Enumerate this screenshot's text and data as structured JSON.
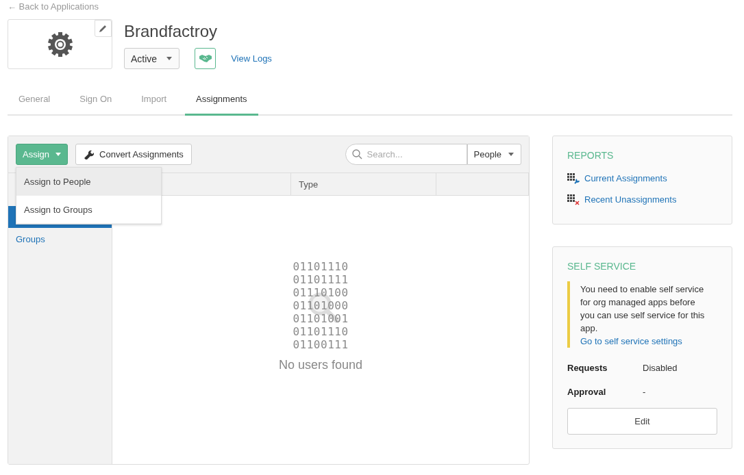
{
  "back_link": "← Back to Applications",
  "app": {
    "name": "Brandfactroy",
    "status": "Active",
    "view_logs": "View Logs"
  },
  "tabs": [
    {
      "label": "General",
      "selected": false
    },
    {
      "label": "Sign On",
      "selected": false
    },
    {
      "label": "Import",
      "selected": false
    },
    {
      "label": "Assignments",
      "selected": true
    }
  ],
  "toolbar": {
    "assign": "Assign",
    "convert": "Convert Assignments",
    "search": {
      "placeholder": "Search..."
    },
    "filter": "People"
  },
  "assign_menu": [
    {
      "label": "Assign to People",
      "selected": true
    },
    {
      "label": "Assign to Groups",
      "selected": false
    }
  ],
  "sidebar": {
    "items": [
      {
        "selected": true
      },
      {
        "label": "Groups",
        "selected": false
      }
    ]
  },
  "table": {
    "columns": [
      {},
      {
        "label": "Type"
      },
      {}
    ]
  },
  "empty_state": {
    "binary": [
      "01101110",
      "01101111",
      "01110100",
      "01101000",
      "01101001",
      "01101110",
      "01100111"
    ],
    "message": "No users found"
  },
  "reports": {
    "title": "REPORTS",
    "links": [
      {
        "label": "Current Assignments",
        "kind": "current"
      },
      {
        "label": "Recent Unassignments",
        "kind": "removed"
      }
    ]
  },
  "self_service": {
    "title": "SELF SERVICE",
    "notice": "You need to enable self service for org managed apps before you can use self service for this app.",
    "notice_link": "Go to self service settings",
    "fields": [
      {
        "label": "Requests",
        "value": "Disabled"
      },
      {
        "label": "Approval",
        "value": "-"
      }
    ],
    "edit": "Edit"
  }
}
